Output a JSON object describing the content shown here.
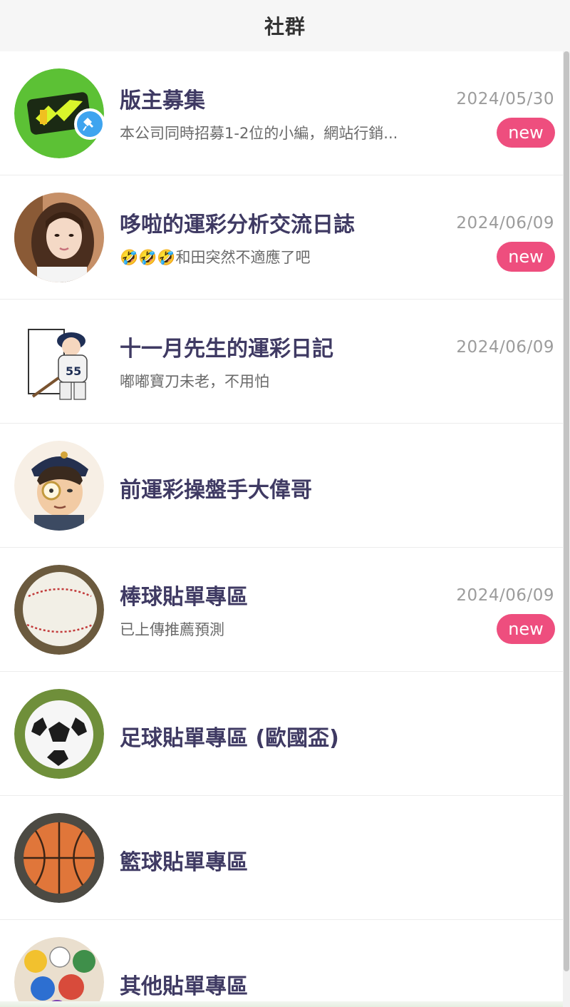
{
  "header": {
    "title": "社群"
  },
  "colors": {
    "accent_new": "#ee4e7e",
    "title_text": "#3f3a63",
    "pin_blue": "#3ea4ef"
  },
  "rows": [
    {
      "title": "版主募集",
      "preview": "本公司同時招募1-2位的小編，網站行銷...",
      "date": "2024/05/30",
      "badge": "new",
      "pinned": true,
      "avatar_icon": "brand-logo-icon"
    },
    {
      "title": "哆啦的運彩分析交流日誌",
      "preview": "🤣🤣🤣和田突然不適應了吧",
      "date": "2024/06/09",
      "badge": "new",
      "avatar_icon": "woman-portrait-avatar"
    },
    {
      "title": "十一月先生的運彩日記",
      "preview": "嘟嘟寶刀未老，不用怕",
      "date": "2024/06/09",
      "avatar_icon": "baseball-player-sketch-avatar"
    },
    {
      "title": "前運彩操盤手大偉哥",
      "avatar_icon": "cartoon-detective-avatar"
    },
    {
      "title": "棒球貼單專區",
      "preview": "已上傳推薦預測",
      "date": "2024/06/09",
      "badge": "new",
      "avatar_icon": "baseball-icon"
    },
    {
      "title": "足球貼單專區 (歐國盃)",
      "avatar_icon": "soccer-ball-icon"
    },
    {
      "title": "籃球貼單專區",
      "avatar_icon": "basketball-icon"
    },
    {
      "title": "其他貼單專區",
      "avatar_icon": "mixed-balls-icon"
    }
  ]
}
